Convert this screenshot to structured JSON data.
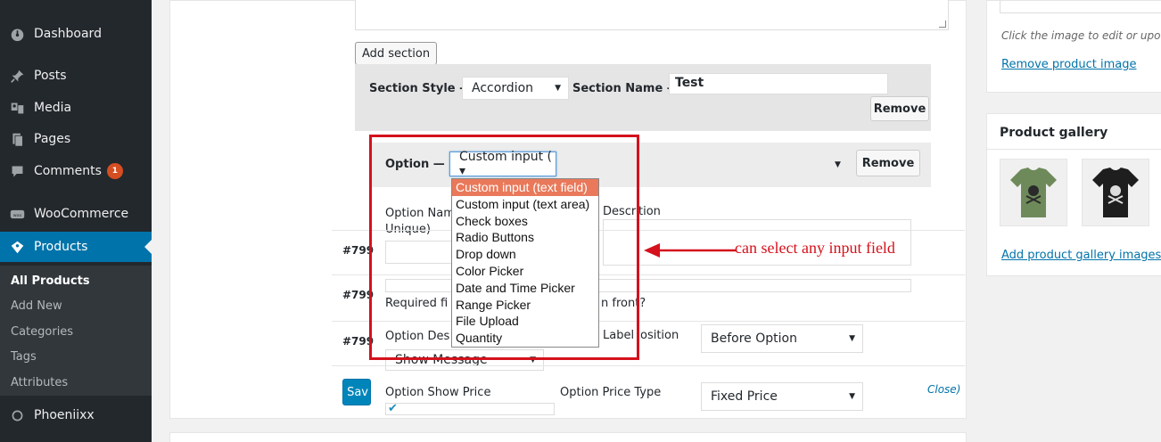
{
  "sidebar": {
    "items": [
      {
        "label": "Dashboard",
        "icon": "dashboard-icon"
      },
      {
        "label": "Posts",
        "icon": "pin-icon"
      },
      {
        "label": "Media",
        "icon": "media-icon"
      },
      {
        "label": "Pages",
        "icon": "pages-icon"
      },
      {
        "label": "Comments",
        "icon": "comment-icon",
        "badge": "1"
      },
      {
        "label": "WooCommerce",
        "icon": "woo-icon"
      },
      {
        "label": "Products",
        "icon": "products-icon",
        "current": true
      },
      {
        "label": "Phoeniixx",
        "icon": "phoeniixx-icon"
      }
    ],
    "submenu": [
      "All Products",
      "Add New",
      "Categories",
      "Tags",
      "Attributes"
    ]
  },
  "editor": {
    "add_section_label": "Add section",
    "section_style_label": "Section Style —",
    "section_style_value": "Accordion",
    "section_name_label": "Section Name —",
    "section_name_value": "Test",
    "remove_label": "Remove",
    "option_label": "Option —",
    "option_select_value": "Custom input ( ▾",
    "option_name_label": "Option Nam",
    "option_name_label2": "Unique)",
    "description_label": "Descri",
    "description_label2": "tion",
    "required_label": "Required fi",
    "required_label2": "n front?",
    "option_desc_label": "Option Des",
    "label_position_label": "Label",
    "label_position_label2": "osition",
    "label_position_value": "Before Option",
    "show_message_value": "Show Message",
    "option_show_price_label": "Option Show Price",
    "option_price_type_label": "Option Price Type",
    "price_type_value": "Fixed Price",
    "row_ids": [
      "#799",
      "#799",
      "#799"
    ],
    "save_label": "Sav",
    "close_label": "Close)"
  },
  "dropdown": {
    "options": [
      "Custom input (text field)",
      "Custom input (text area)",
      "Check boxes",
      "Radio Buttons",
      "Drop down",
      "Color Picker",
      "Date and Time Picker",
      "Range Picker",
      "File Upload",
      "Quantity"
    ],
    "highlighted_index": 0,
    "highlight_color": "#e9795a"
  },
  "annotation": {
    "text": "can select any input field",
    "color": "#d4111c"
  },
  "right_column": {
    "edit_hint": "Click the image to edit or upo",
    "remove_image_link": "Remove product image",
    "gallery_title": "Product gallery",
    "add_gallery_link": "Add product gallery images",
    "gallery_thumbs": [
      {
        "icon": "green-tshirt-icon",
        "color": "#6e8a5a"
      },
      {
        "icon": "black-tshirt-icon",
        "color": "#1e1e1e"
      }
    ]
  },
  "colors": {
    "sidebar_bg": "#23282d",
    "accent": "#0073aa",
    "badge": "#d54e21"
  }
}
